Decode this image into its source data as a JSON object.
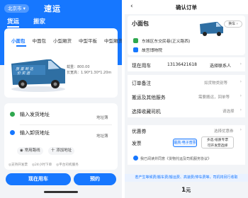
{
  "left": {
    "city": "北京市",
    "city_caret": "▾",
    "brand": "速运",
    "tabs": [
      "货运",
      "搬家"
    ],
    "vehicle_tabs": [
      "小面包",
      "中面包",
      "小型厢货",
      "中型平板",
      "中型厢货"
    ],
    "van_banner": "放首到达 价实送 ",
    "spec_weight": "载重：800.00",
    "spec_size": "长宽高：1.90*1.30*1.20m",
    "addr_from": "输入发货地址",
    "addr_to": "输入卸货地址",
    "addr_book": "地址簿",
    "common_route": "常用路线",
    "add_stop": "十 添加地址",
    "tips": [
      "◎支持开发票",
      "◎24小时下单",
      "◎平台司机服务"
    ],
    "btn_now": "现在用车",
    "btn_book": "预约"
  },
  "right": {
    "back": "‹",
    "title": "确认订单",
    "vehicle": "小面包",
    "swap_label": "换车 ›",
    "from_addr": "东城区东交民巷(正义路西)",
    "to_addr": "故宫博物院",
    "rows": {
      "contact_label": "现在用车",
      "contact_phone": "13136421618",
      "contact_choose": "选择联系人",
      "remark_label": "订单备注",
      "remark_hint": "如货物类别等",
      "service_label": "搬运及其他服务",
      "service_hint": "需要搬运，回单等",
      "driver_label": "选择收藏司机",
      "driver_hint": "请选择",
      "coupon_label": "优惠券",
      "coupon_hint": "选择优惠券",
      "invoice_label": "发票",
      "invoice_electronic": "最高·电子普票",
      "invoice_paper_1": "多选·纸质专票",
      "invoice_paper_2": "可开发票选择"
    },
    "agree": "我已阅读并同意《货物托运及司机服务协议》",
    "notice": "若产生等候费/搬车费/搬运费、高速费/停车费等，司机将另行收取",
    "price_num": "1",
    "price_unit": "元",
    "chev": "›"
  },
  "colors": {
    "brand_blue": "#1677ff",
    "van_blue": "#2f6fa3",
    "green": "#2fa84f"
  }
}
